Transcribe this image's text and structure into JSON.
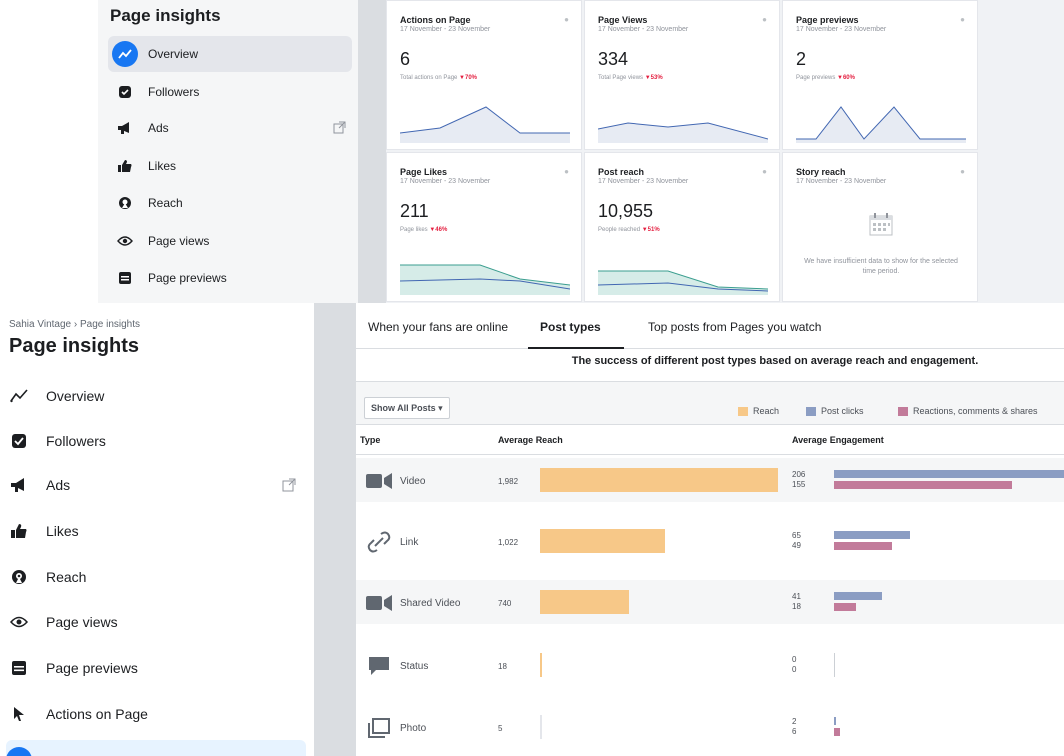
{
  "colors": {
    "reach": "#f7c888",
    "post_clicks": "#8b9dc3",
    "reactions": "#c27b9a",
    "accent": "#1877f2",
    "negative_delta": "#e41e3f"
  },
  "top": {
    "title": "Page insights",
    "sidebar": [
      {
        "label": "Overview",
        "icon": "overview-icon",
        "active": true
      },
      {
        "label": "Followers",
        "icon": "followers-icon"
      },
      {
        "label": "Ads",
        "icon": "megaphone-icon",
        "external": true
      },
      {
        "label": "Likes",
        "icon": "thumbs-up-icon"
      },
      {
        "label": "Reach",
        "icon": "reach-icon"
      },
      {
        "label": "Page views",
        "icon": "eye-icon"
      },
      {
        "label": "Page previews",
        "icon": "page-preview-icon"
      }
    ],
    "cards": [
      {
        "title": "Actions on Page",
        "date": "17 November - 23 November",
        "value": "6",
        "sub": "Total actions on Page",
        "delta": "▼70%"
      },
      {
        "title": "Page Views",
        "date": "17 November - 23 November",
        "value": "334",
        "sub": "Total Page views",
        "delta": "▼53%"
      },
      {
        "title": "Page previews",
        "date": "17 November - 23 November",
        "value": "2",
        "sub": "Page previews",
        "delta": "▼60%"
      },
      {
        "title": "Page Likes",
        "date": "17 November - 23 November",
        "value": "211",
        "sub": "Page likes",
        "delta": "▼46%"
      },
      {
        "title": "Post reach",
        "date": "17 November - 23 November",
        "value": "10,955",
        "sub": "People reached",
        "delta": "▼51%"
      },
      {
        "title": "Story reach",
        "date": "17 November - 23 November",
        "empty_text": "We have insufficient data to show for the selected time period."
      }
    ]
  },
  "bottom": {
    "breadcrumb": "Sahia Vintage › Page insights",
    "title": "Page insights",
    "sidebar": [
      {
        "label": "Overview",
        "icon": "overview-icon"
      },
      {
        "label": "Followers",
        "icon": "followers-icon"
      },
      {
        "label": "Ads",
        "icon": "megaphone-icon",
        "external": true
      },
      {
        "label": "Likes",
        "icon": "thumbs-up-icon"
      },
      {
        "label": "Reach",
        "icon": "reach-icon"
      },
      {
        "label": "Page views",
        "icon": "eye-icon"
      },
      {
        "label": "Page previews",
        "icon": "page-preview-icon"
      },
      {
        "label": "Actions on Page",
        "icon": "cursor-icon"
      }
    ],
    "tabs": [
      "When your fans are online",
      "Post types",
      "Top posts from Pages you watch"
    ],
    "active_tab": "Post types",
    "subtitle": "The success of different post types based on average reach and engagement.",
    "filter": "Show All Posts ▾",
    "legend": [
      "Reach",
      "Post clicks",
      "Reactions, comments & shares"
    ],
    "columns": [
      "Type",
      "Average Reach",
      "Average Engagement"
    ],
    "rows": [
      {
        "type": "Video",
        "icon": "video-icon",
        "reach": 1982,
        "reach_label": "1,982",
        "clicks": 206,
        "reactions": 155
      },
      {
        "type": "Link",
        "icon": "link-icon",
        "reach": 1022,
        "reach_label": "1,022",
        "clicks": 65,
        "reactions": 49
      },
      {
        "type": "Shared Video",
        "icon": "video-icon",
        "reach": 740,
        "reach_label": "740",
        "clicks": 41,
        "reactions": 18
      },
      {
        "type": "Status",
        "icon": "status-icon",
        "reach": 18,
        "reach_label": "18",
        "clicks": 0,
        "reactions": 0
      },
      {
        "type": "Photo",
        "icon": "photo-icon",
        "reach": 5,
        "reach_label": "5",
        "clicks": 2,
        "reactions": 6
      }
    ]
  }
}
